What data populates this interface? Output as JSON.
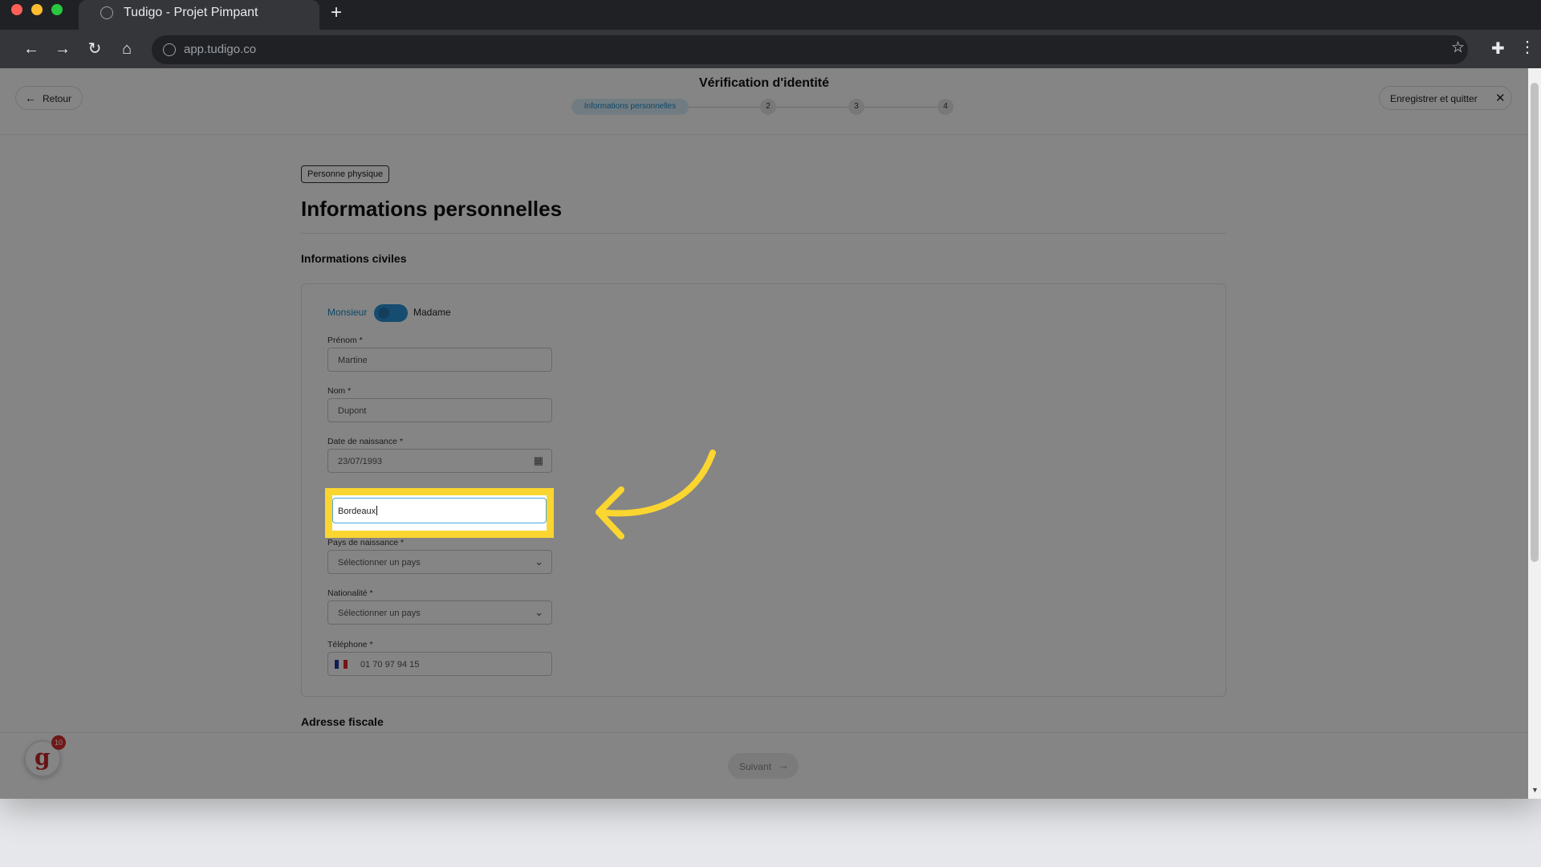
{
  "browser": {
    "tab_title": "Tudigo - Projet Pimpant",
    "new_tab": "+",
    "url": "app.tudigo.co"
  },
  "header": {
    "back_label": "Retour",
    "title": "Vérification d'identité",
    "steps": [
      "Informations personnelles",
      "2",
      "3",
      "4"
    ],
    "current_step": 1,
    "save_quit_label": "Enregistrer et quitter"
  },
  "form": {
    "chip": "Personne physique",
    "title": "Informations personnelles",
    "section_civil": "Informations civiles",
    "gender": {
      "left": "Monsieur",
      "right": "Madame",
      "selected": "Madame"
    },
    "fields": {
      "prenom": {
        "label": "Prénom *",
        "value": "Martine"
      },
      "nom": {
        "label": "Nom *",
        "value": "Dupont"
      },
      "naissance": {
        "label": "Date de naissance *",
        "value": "23/07/1993"
      },
      "ville": {
        "value": "Bordeaux"
      },
      "pays": {
        "label": "Pays de naissance *",
        "value": "Sélectionner un pays"
      },
      "nationalite": {
        "label": "Nationalité *",
        "value": "Sélectionner un pays"
      },
      "telephone": {
        "label": "Téléphone *",
        "value": "01 70 97 94 15"
      }
    },
    "section_address": "Adresse fiscale"
  },
  "footer": {
    "next_label": "Suivant"
  },
  "badge": {
    "letter": "g",
    "count": "10"
  },
  "colors": {
    "accent": "#2a93d5",
    "highlight": "#fbd530",
    "overlay": "rgba(0,0,0,0.48)"
  }
}
